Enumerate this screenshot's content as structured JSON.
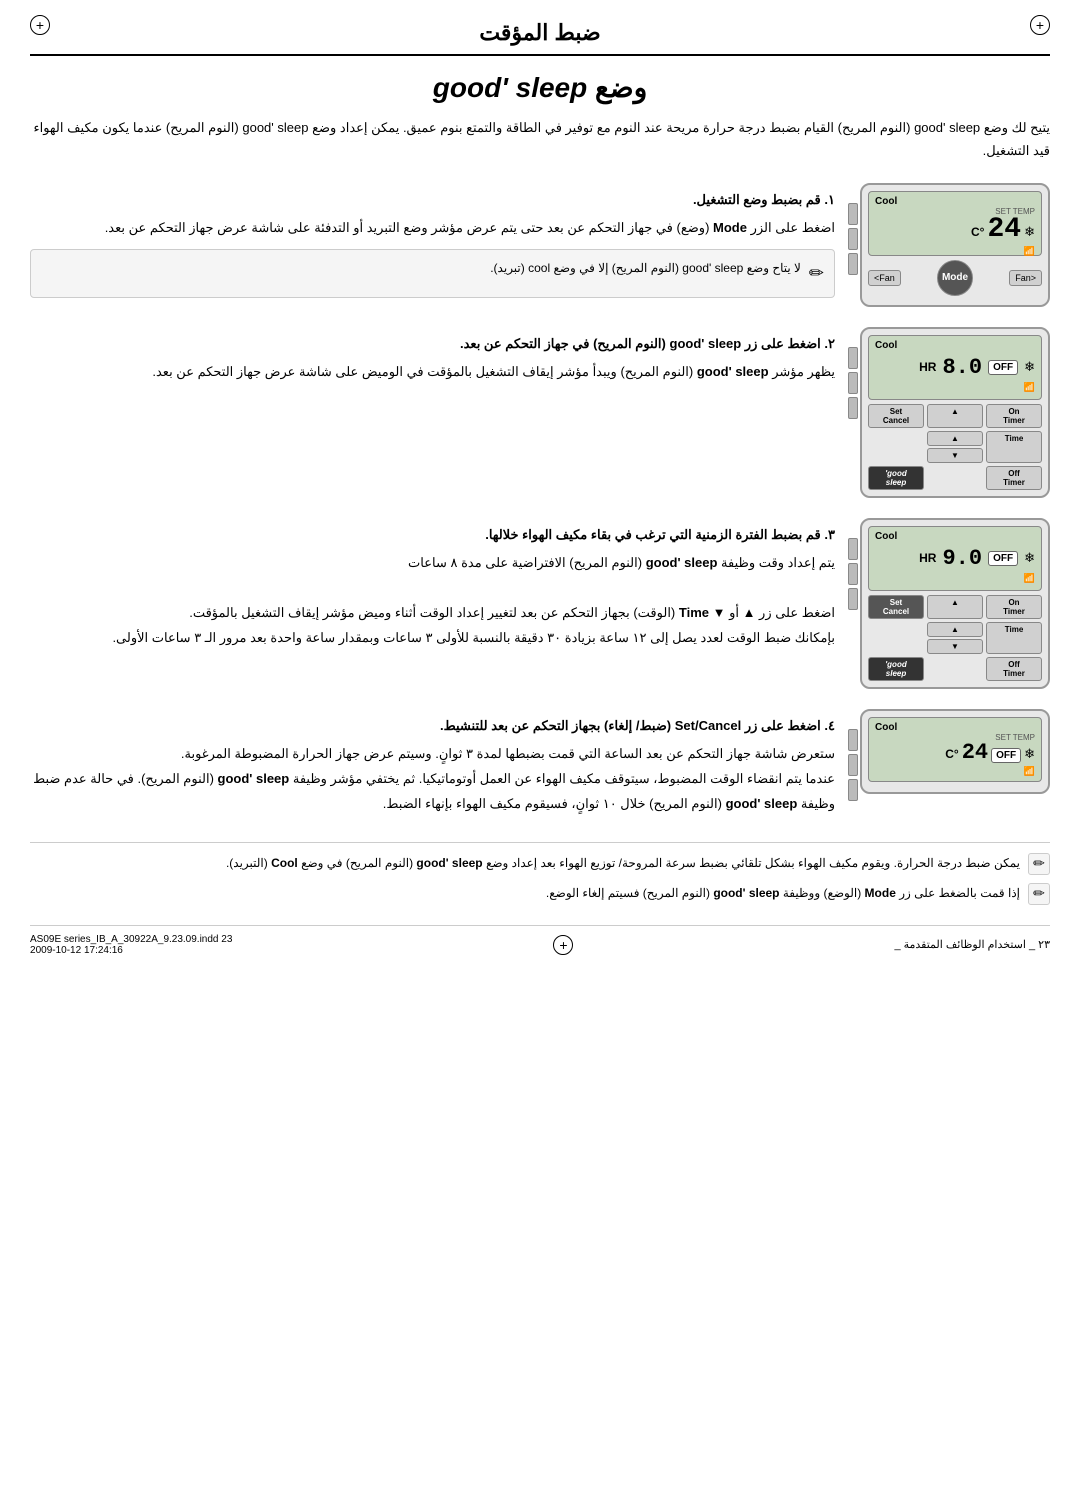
{
  "page": {
    "title": "ضبط المؤقت",
    "section_title_arabic": "وضع",
    "section_title_english": "good' sleep",
    "intro": "يتيح لك وضع good' sleep (النوم المريح) القيام بضبط درجة حرارة مريحة عند النوم مع توفير في الطاقة والتمتع بنوم عميق. يمكن إعداد وضع good' sleep (النوم المريح) عندما يكون مكيف الهواء قيد التشغيل.",
    "steps": [
      {
        "number": "١",
        "heading": "قم بضبط وضع التشغيل.",
        "detail": "اضغط على الزر Mode (وضع) في جهاز التحكم عن بعد حتى يتم عرض مؤشر وضع التبريد أو التدفئة على شاشة عرض جهاز التحكم عن بعد.",
        "remote_type": "mode"
      },
      {
        "number": "٢",
        "heading": "اضغط على زر good' sleep (النوم المريح) في جهاز التحكم عن بعد.",
        "detail": "يظهر مؤشر good' sleep (النوم المريح) ويبدأ مؤشر إيقاف التشغيل بالمؤقت في الوميض على شاشة عرض جهاز التحكم عن بعد.",
        "remote_type": "sleep1"
      },
      {
        "number": "٣",
        "heading": "قم بضبط الفترة الزمنية التي ترغب في بقاء مكيف الهواء خلالها.",
        "detail": "يتم إعداد وقت وظيفة good' sleep (النوم المريح) الافتراضية على مدة ٨ ساعات\n\nاضغط على زر ▲ أو ▼ Time (الوقت) بجهاز التحكم عن بعد لتغيير إعداد الوقت أثناء وميض مؤشر إيقاف التشغيل بالمؤقت.\nبإمكانك ضبط الوقت لعدد يصل إلى ١٢ ساعة بزيادة ٣٠ دقيقة بالنسبة للأولى ٣ ساعات وبمقدار ساعة واحدة بعد مرور الـ ٣ ساعات الأولى.",
        "remote_type": "sleep2"
      },
      {
        "number": "٤",
        "heading": "اضغط على زر Set/Cancel (ضبط/ إلغاء) بجهاز التحكم عن بعد للتنشيط.",
        "detail": "ستعرض شاشة جهاز التحكم عن بعد الساعة التي قمت بضبطها لمدة ٣ ثوانٍ. وسيتم عرض جهاز الحرارة المضبوطة المرغوبة.\nعندما يتم انقضاء الوقت المضبوط، سيتوقف مكيف الهواء عن العمل أوتوماتيكيا. ثم يختفي مؤشر وظيفة good' sleep (النوم المريح). في حالة عدم ضبط وظيفة good' sleep (النوم المريح) خلال ١٠ ثوانٍ، فسيقوم مكيف الهواء بإنهاء الضبط.",
        "remote_type": "set"
      }
    ],
    "note_inline": "لا يتاح وضع good' sleep (النوم المريح) إلا في وضع cool (تبريد).",
    "bottom_notes": [
      "يمكن ضبط درجة الحرارة. ويقوم مكيف الهواء بشكل تلقائي بضبط سرعة المروحة/ توزيع الهواء بعد إعداد وضع good' sleep (النوم المريح) في وضع Cool (التبريد).",
      "إذا قمت بالضغط على زر Mode (الوضع) ووظيفة good' sleep (النوم المريح) فسيتم إلغاء الوضع."
    ],
    "footer": {
      "page_number": "٢٣",
      "footer_text": "استخدام الوظائف المتقدمة _",
      "file_info": "AS09E series_IB_A_30922A_9.23.09.indd  23",
      "date_info": "2009-10-12  17:24:16"
    },
    "remotes": {
      "cool_24": {
        "mode": "Cool",
        "set_temp": "SET TEMP",
        "temp": "24",
        "unit": "°C",
        "off": false
      },
      "cool_80_off": {
        "mode": "Cool",
        "temp": "8.0",
        "off_badge": "OFF",
        "hr": "HR",
        "hr_val": "8.0"
      },
      "cool_90_off": {
        "mode": "Cool",
        "temp": "9.0",
        "off_badge": "OFF",
        "hr": "HR",
        "hr_val": "9.0"
      },
      "cool_24_off": {
        "mode": "Cool",
        "set_temp": "SET TEMP",
        "temp": "24",
        "unit": "°C",
        "off_badge": "OFF"
      }
    },
    "buttons": {
      "on_timer": "On Timer",
      "set_cancel": "Set Cancel",
      "time": "Time",
      "off_timer": "Off Timer",
      "good_sleep": "good' sleep",
      "fan_left": "<Fan",
      "fan_right": "Fan>",
      "mode": "Mode"
    }
  }
}
